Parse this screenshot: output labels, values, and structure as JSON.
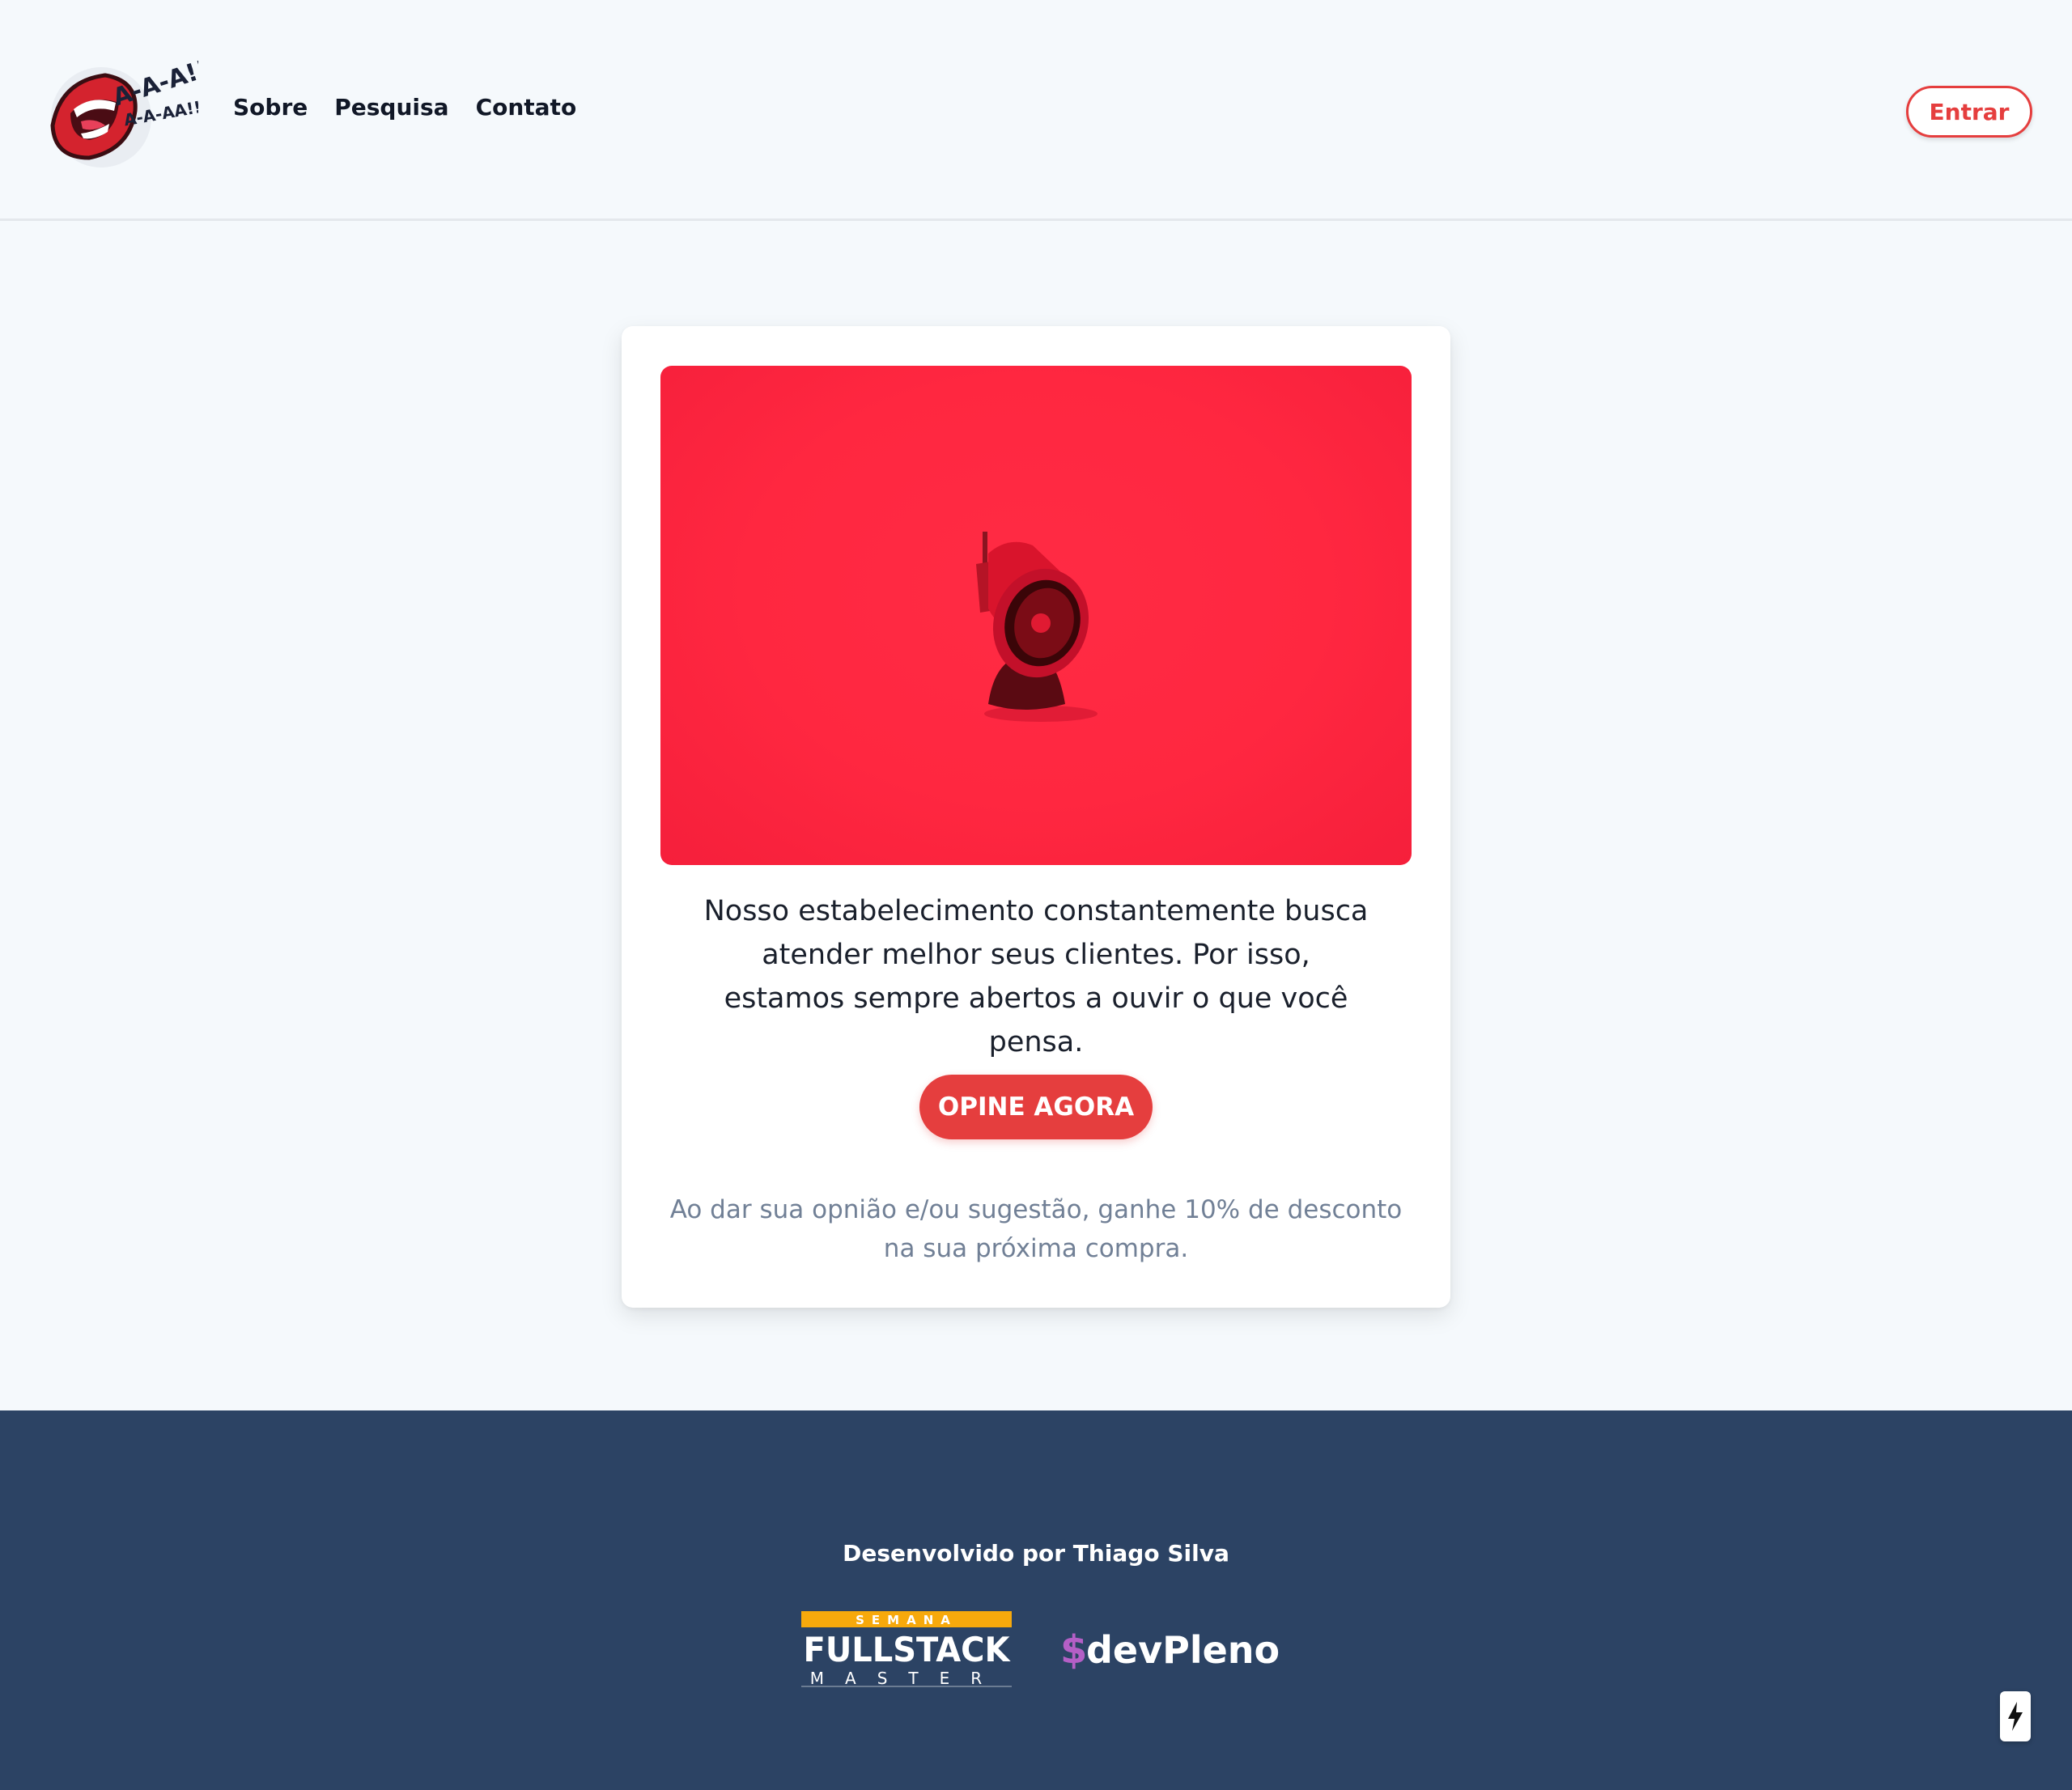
{
  "header": {
    "logo_text_top": "A-A-A!!",
    "logo_text_bottom": "A-A-AA!!",
    "nav": [
      "Sobre",
      "Pesquisa",
      "Contato"
    ],
    "login_label": "Entrar"
  },
  "card": {
    "description": "Nosso estabelecimento constantemente busca atender melhor seus clientes. Por isso, estamos sempre abertos a ouvir o que você pensa.",
    "cta_label": "OPINE AGORA",
    "note": "Ao dar sua opnião e/ou sugestão, ganhe 10% de desconto na sua próxima compra."
  },
  "footer": {
    "credit": "Desenvolvido por Thiago Silva",
    "fullstack_semana": "SEMANA",
    "fullstack_main": "FULLSTACK",
    "fullstack_master": "MASTER",
    "devpleno_symbol": "$",
    "devpleno_name": "devPleno"
  },
  "colors": {
    "accent": "#e53e3e",
    "hero_red": "#ff2740",
    "footer_bg": "#2c4364",
    "page_bg": "#f5f9fc",
    "devpleno_purple": "#b45fc6",
    "fullstack_yellow": "#f7a90c"
  },
  "icons": {
    "hero": "megaphone-icon",
    "fab": "lightning-bolt-icon"
  }
}
